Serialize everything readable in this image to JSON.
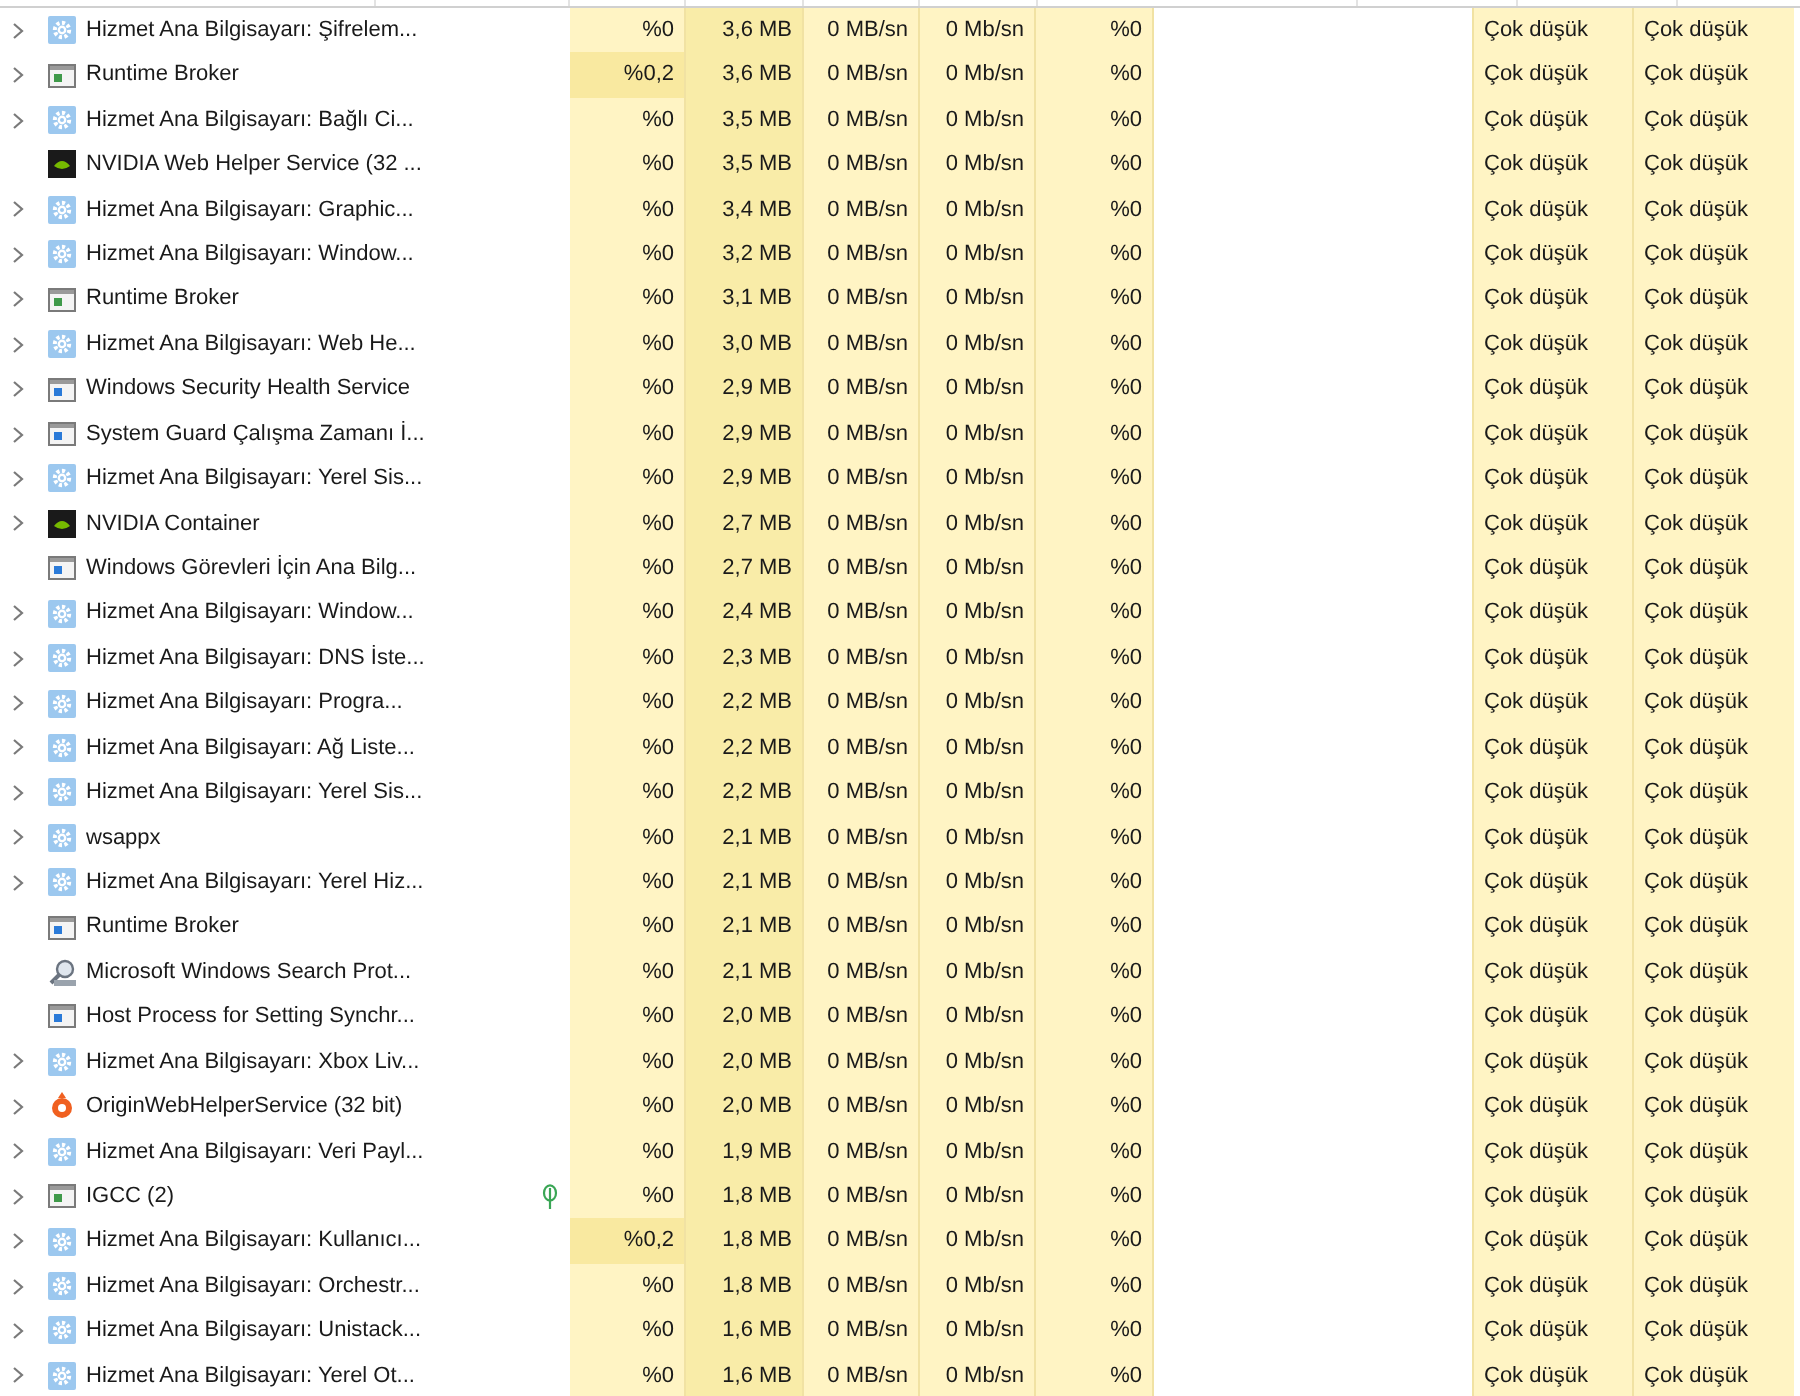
{
  "rows": [
    {
      "kind": "service",
      "name": "Hizmet Ana Bilgisayarı: Şifrelem...",
      "expandable": true,
      "eco": false,
      "cpu_highlighted": false,
      "cpu": "%0",
      "memory": "3,6 MB",
      "disk": "0 MB/sn",
      "network": "0 Mb/sn",
      "gpu": "%0",
      "power": "Çok düşük",
      "power_trend": "Çok düşük"
    },
    {
      "kind": "app_green",
      "name": "Runtime Broker",
      "expandable": true,
      "eco": false,
      "cpu_highlighted": true,
      "cpu": "%0,2",
      "memory": "3,6 MB",
      "disk": "0 MB/sn",
      "network": "0 Mb/sn",
      "gpu": "%0",
      "power": "Çok düşük",
      "power_trend": "Çok düşük"
    },
    {
      "kind": "service",
      "name": "Hizmet Ana Bilgisayarı: Bağlı Ci...",
      "expandable": true,
      "eco": false,
      "cpu_highlighted": false,
      "cpu": "%0",
      "memory": "3,5 MB",
      "disk": "0 MB/sn",
      "network": "0 Mb/sn",
      "gpu": "%0",
      "power": "Çok düşük",
      "power_trend": "Çok düşük"
    },
    {
      "kind": "nvidia",
      "name": "NVIDIA Web Helper Service (32 ...",
      "expandable": false,
      "eco": false,
      "cpu_highlighted": false,
      "cpu": "%0",
      "memory": "3,5 MB",
      "disk": "0 MB/sn",
      "network": "0 Mb/sn",
      "gpu": "%0",
      "power": "Çok düşük",
      "power_trend": "Çok düşük"
    },
    {
      "kind": "service",
      "name": "Hizmet Ana Bilgisayarı: Graphic...",
      "expandable": true,
      "eco": false,
      "cpu_highlighted": false,
      "cpu": "%0",
      "memory": "3,4 MB",
      "disk": "0 MB/sn",
      "network": "0 Mb/sn",
      "gpu": "%0",
      "power": "Çok düşük",
      "power_trend": "Çok düşük"
    },
    {
      "kind": "service",
      "name": "Hizmet Ana Bilgisayarı: Window...",
      "expandable": true,
      "eco": false,
      "cpu_highlighted": false,
      "cpu": "%0",
      "memory": "3,2 MB",
      "disk": "0 MB/sn",
      "network": "0 Mb/sn",
      "gpu": "%0",
      "power": "Çok düşük",
      "power_trend": "Çok düşük"
    },
    {
      "kind": "app_green",
      "name": "Runtime Broker",
      "expandable": true,
      "eco": false,
      "cpu_highlighted": false,
      "cpu": "%0",
      "memory": "3,1 MB",
      "disk": "0 MB/sn",
      "network": "0 Mb/sn",
      "gpu": "%0",
      "power": "Çok düşük",
      "power_trend": "Çok düşük"
    },
    {
      "kind": "service",
      "name": "Hizmet Ana Bilgisayarı: Web He...",
      "expandable": true,
      "eco": false,
      "cpu_highlighted": false,
      "cpu": "%0",
      "memory": "3,0 MB",
      "disk": "0 MB/sn",
      "network": "0 Mb/sn",
      "gpu": "%0",
      "power": "Çok düşük",
      "power_trend": "Çok düşük"
    },
    {
      "kind": "app_blue",
      "name": "Windows Security Health Service",
      "expandable": true,
      "eco": false,
      "cpu_highlighted": false,
      "cpu": "%0",
      "memory": "2,9 MB",
      "disk": "0 MB/sn",
      "network": "0 Mb/sn",
      "gpu": "%0",
      "power": "Çok düşük",
      "power_trend": "Çok düşük"
    },
    {
      "kind": "app_blue",
      "name": "System Guard Çalışma Zamanı İ...",
      "expandable": true,
      "eco": false,
      "cpu_highlighted": false,
      "cpu": "%0",
      "memory": "2,9 MB",
      "disk": "0 MB/sn",
      "network": "0 Mb/sn",
      "gpu": "%0",
      "power": "Çok düşük",
      "power_trend": "Çok düşük"
    },
    {
      "kind": "service",
      "name": "Hizmet Ana Bilgisayarı: Yerel Sis...",
      "expandable": true,
      "eco": false,
      "cpu_highlighted": false,
      "cpu": "%0",
      "memory": "2,9 MB",
      "disk": "0 MB/sn",
      "network": "0 Mb/sn",
      "gpu": "%0",
      "power": "Çok düşük",
      "power_trend": "Çok düşük"
    },
    {
      "kind": "nvidia",
      "name": "NVIDIA Container",
      "expandable": true,
      "eco": false,
      "cpu_highlighted": false,
      "cpu": "%0",
      "memory": "2,7 MB",
      "disk": "0 MB/sn",
      "network": "0 Mb/sn",
      "gpu": "%0",
      "power": "Çok düşük",
      "power_trend": "Çok düşük"
    },
    {
      "kind": "app_blue",
      "name": "Windows Görevleri İçin Ana Bilg...",
      "expandable": false,
      "eco": false,
      "cpu_highlighted": false,
      "cpu": "%0",
      "memory": "2,7 MB",
      "disk": "0 MB/sn",
      "network": "0 Mb/sn",
      "gpu": "%0",
      "power": "Çok düşük",
      "power_trend": "Çok düşük"
    },
    {
      "kind": "service",
      "name": "Hizmet Ana Bilgisayarı: Window...",
      "expandable": true,
      "eco": false,
      "cpu_highlighted": false,
      "cpu": "%0",
      "memory": "2,4 MB",
      "disk": "0 MB/sn",
      "network": "0 Mb/sn",
      "gpu": "%0",
      "power": "Çok düşük",
      "power_trend": "Çok düşük"
    },
    {
      "kind": "service",
      "name": "Hizmet Ana Bilgisayarı: DNS İste...",
      "expandable": true,
      "eco": false,
      "cpu_highlighted": false,
      "cpu": "%0",
      "memory": "2,3 MB",
      "disk": "0 MB/sn",
      "network": "0 Mb/sn",
      "gpu": "%0",
      "power": "Çok düşük",
      "power_trend": "Çok düşük"
    },
    {
      "kind": "service",
      "name": "Hizmet Ana Bilgisayarı: Progra...",
      "expandable": true,
      "eco": false,
      "cpu_highlighted": false,
      "cpu": "%0",
      "memory": "2,2 MB",
      "disk": "0 MB/sn",
      "network": "0 Mb/sn",
      "gpu": "%0",
      "power": "Çok düşük",
      "power_trend": "Çok düşük"
    },
    {
      "kind": "service",
      "name": "Hizmet Ana Bilgisayarı: Ağ Liste...",
      "expandable": true,
      "eco": false,
      "cpu_highlighted": false,
      "cpu": "%0",
      "memory": "2,2 MB",
      "disk": "0 MB/sn",
      "network": "0 Mb/sn",
      "gpu": "%0",
      "power": "Çok düşük",
      "power_trend": "Çok düşük"
    },
    {
      "kind": "service",
      "name": "Hizmet Ana Bilgisayarı: Yerel Sis...",
      "expandable": true,
      "eco": false,
      "cpu_highlighted": false,
      "cpu": "%0",
      "memory": "2,2 MB",
      "disk": "0 MB/sn",
      "network": "0 Mb/sn",
      "gpu": "%0",
      "power": "Çok düşük",
      "power_trend": "Çok düşük"
    },
    {
      "kind": "service",
      "name": "wsappx",
      "expandable": true,
      "eco": false,
      "cpu_highlighted": false,
      "cpu": "%0",
      "memory": "2,1 MB",
      "disk": "0 MB/sn",
      "network": "0 Mb/sn",
      "gpu": "%0",
      "power": "Çok düşük",
      "power_trend": "Çok düşük"
    },
    {
      "kind": "service",
      "name": "Hizmet Ana Bilgisayarı: Yerel Hiz...",
      "expandable": true,
      "eco": false,
      "cpu_highlighted": false,
      "cpu": "%0",
      "memory": "2,1 MB",
      "disk": "0 MB/sn",
      "network": "0 Mb/sn",
      "gpu": "%0",
      "power": "Çok düşük",
      "power_trend": "Çok düşük"
    },
    {
      "kind": "app_blue",
      "name": "Runtime Broker",
      "expandable": false,
      "eco": false,
      "cpu_highlighted": false,
      "cpu": "%0",
      "memory": "2,1 MB",
      "disk": "0 MB/sn",
      "network": "0 Mb/sn",
      "gpu": "%0",
      "power": "Çok düşük",
      "power_trend": "Çok düşük"
    },
    {
      "kind": "search",
      "name": "Microsoft Windows Search Prot...",
      "expandable": false,
      "eco": false,
      "cpu_highlighted": false,
      "cpu": "%0",
      "memory": "2,1 MB",
      "disk": "0 MB/sn",
      "network": "0 Mb/sn",
      "gpu": "%0",
      "power": "Çok düşük",
      "power_trend": "Çok düşük"
    },
    {
      "kind": "app_blue",
      "name": "Host Process for Setting Synchr...",
      "expandable": false,
      "eco": false,
      "cpu_highlighted": false,
      "cpu": "%0",
      "memory": "2,0 MB",
      "disk": "0 MB/sn",
      "network": "0 Mb/sn",
      "gpu": "%0",
      "power": "Çok düşük",
      "power_trend": "Çok düşük"
    },
    {
      "kind": "service",
      "name": "Hizmet Ana Bilgisayarı: Xbox Liv...",
      "expandable": true,
      "eco": false,
      "cpu_highlighted": false,
      "cpu": "%0",
      "memory": "2,0 MB",
      "disk": "0 MB/sn",
      "network": "0 Mb/sn",
      "gpu": "%0",
      "power": "Çok düşük",
      "power_trend": "Çok düşük"
    },
    {
      "kind": "origin",
      "name": "OriginWebHelperService (32 bit)",
      "expandable": true,
      "eco": false,
      "cpu_highlighted": false,
      "cpu": "%0",
      "memory": "2,0 MB",
      "disk": "0 MB/sn",
      "network": "0 Mb/sn",
      "gpu": "%0",
      "power": "Çok düşük",
      "power_trend": "Çok düşük"
    },
    {
      "kind": "service",
      "name": "Hizmet Ana Bilgisayarı: Veri Payl...",
      "expandable": true,
      "eco": false,
      "cpu_highlighted": false,
      "cpu": "%0",
      "memory": "1,9 MB",
      "disk": "0 MB/sn",
      "network": "0 Mb/sn",
      "gpu": "%0",
      "power": "Çok düşük",
      "power_trend": "Çok düşük"
    },
    {
      "kind": "app_green",
      "name": "IGCC (2)",
      "expandable": true,
      "eco": true,
      "cpu_highlighted": false,
      "cpu": "%0",
      "memory": "1,8 MB",
      "disk": "0 MB/sn",
      "network": "0 Mb/sn",
      "gpu": "%0",
      "power": "Çok düşük",
      "power_trend": "Çok düşük"
    },
    {
      "kind": "service",
      "name": "Hizmet Ana Bilgisayarı: Kullanıcı...",
      "expandable": true,
      "eco": false,
      "cpu_highlighted": true,
      "cpu": "%0,2",
      "memory": "1,8 MB",
      "disk": "0 MB/sn",
      "network": "0 Mb/sn",
      "gpu": "%0",
      "power": "Çok düşük",
      "power_trend": "Çok düşük"
    },
    {
      "kind": "service",
      "name": "Hizmet Ana Bilgisayarı: Orchestr...",
      "expandable": true,
      "eco": false,
      "cpu_highlighted": false,
      "cpu": "%0",
      "memory": "1,8 MB",
      "disk": "0 MB/sn",
      "network": "0 Mb/sn",
      "gpu": "%0",
      "power": "Çok düşük",
      "power_trend": "Çok düşük"
    },
    {
      "kind": "service",
      "name": "Hizmet Ana Bilgisayarı: Unistack...",
      "expandable": true,
      "eco": false,
      "cpu_highlighted": false,
      "cpu": "%0",
      "memory": "1,6 MB",
      "disk": "0 MB/sn",
      "network": "0 Mb/sn",
      "gpu": "%0",
      "power": "Çok düşük",
      "power_trend": "Çok düşük"
    },
    {
      "kind": "service",
      "name": "Hizmet Ana Bilgisayarı: Yerel Ot...",
      "expandable": true,
      "eco": false,
      "cpu_highlighted": false,
      "cpu": "%0",
      "memory": "1,6 MB",
      "disk": "0 MB/sn",
      "network": "0 Mb/sn",
      "gpu": "%0",
      "power": "Çok düşük",
      "power_trend": "Çok düşük"
    }
  ]
}
